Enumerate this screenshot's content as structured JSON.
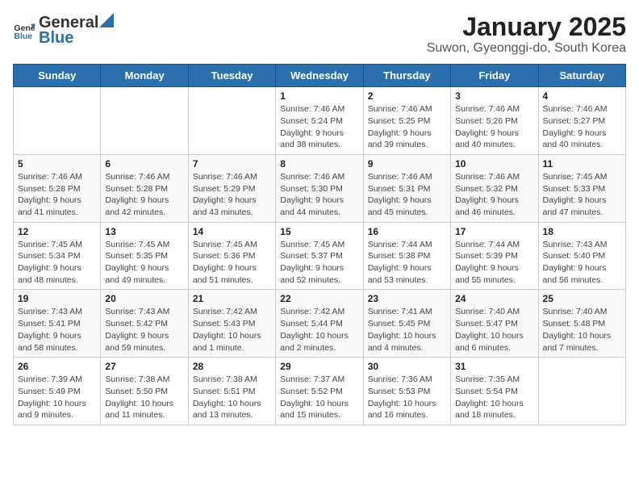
{
  "header": {
    "logo_general": "General",
    "logo_blue": "Blue",
    "title": "January 2025",
    "subtitle": "Suwon, Gyeonggi-do, South Korea"
  },
  "weekdays": [
    "Sunday",
    "Monday",
    "Tuesday",
    "Wednesday",
    "Thursday",
    "Friday",
    "Saturday"
  ],
  "weeks": [
    [
      {
        "day": "",
        "info": ""
      },
      {
        "day": "",
        "info": ""
      },
      {
        "day": "",
        "info": ""
      },
      {
        "day": "1",
        "info": "Sunrise: 7:46 AM\nSunset: 5:24 PM\nDaylight: 9 hours and 38 minutes."
      },
      {
        "day": "2",
        "info": "Sunrise: 7:46 AM\nSunset: 5:25 PM\nDaylight: 9 hours and 39 minutes."
      },
      {
        "day": "3",
        "info": "Sunrise: 7:46 AM\nSunset: 5:26 PM\nDaylight: 9 hours and 40 minutes."
      },
      {
        "day": "4",
        "info": "Sunrise: 7:46 AM\nSunset: 5:27 PM\nDaylight: 9 hours and 40 minutes."
      }
    ],
    [
      {
        "day": "5",
        "info": "Sunrise: 7:46 AM\nSunset: 5:28 PM\nDaylight: 9 hours and 41 minutes."
      },
      {
        "day": "6",
        "info": "Sunrise: 7:46 AM\nSunset: 5:28 PM\nDaylight: 9 hours and 42 minutes."
      },
      {
        "day": "7",
        "info": "Sunrise: 7:46 AM\nSunset: 5:29 PM\nDaylight: 9 hours and 43 minutes."
      },
      {
        "day": "8",
        "info": "Sunrise: 7:46 AM\nSunset: 5:30 PM\nDaylight: 9 hours and 44 minutes."
      },
      {
        "day": "9",
        "info": "Sunrise: 7:46 AM\nSunset: 5:31 PM\nDaylight: 9 hours and 45 minutes."
      },
      {
        "day": "10",
        "info": "Sunrise: 7:46 AM\nSunset: 5:32 PM\nDaylight: 9 hours and 46 minutes."
      },
      {
        "day": "11",
        "info": "Sunrise: 7:45 AM\nSunset: 5:33 PM\nDaylight: 9 hours and 47 minutes."
      }
    ],
    [
      {
        "day": "12",
        "info": "Sunrise: 7:45 AM\nSunset: 5:34 PM\nDaylight: 9 hours and 48 minutes."
      },
      {
        "day": "13",
        "info": "Sunrise: 7:45 AM\nSunset: 5:35 PM\nDaylight: 9 hours and 49 minutes."
      },
      {
        "day": "14",
        "info": "Sunrise: 7:45 AM\nSunset: 5:36 PM\nDaylight: 9 hours and 51 minutes."
      },
      {
        "day": "15",
        "info": "Sunrise: 7:45 AM\nSunset: 5:37 PM\nDaylight: 9 hours and 52 minutes."
      },
      {
        "day": "16",
        "info": "Sunrise: 7:44 AM\nSunset: 5:38 PM\nDaylight: 9 hours and 53 minutes."
      },
      {
        "day": "17",
        "info": "Sunrise: 7:44 AM\nSunset: 5:39 PM\nDaylight: 9 hours and 55 minutes."
      },
      {
        "day": "18",
        "info": "Sunrise: 7:43 AM\nSunset: 5:40 PM\nDaylight: 9 hours and 56 minutes."
      }
    ],
    [
      {
        "day": "19",
        "info": "Sunrise: 7:43 AM\nSunset: 5:41 PM\nDaylight: 9 hours and 58 minutes."
      },
      {
        "day": "20",
        "info": "Sunrise: 7:43 AM\nSunset: 5:42 PM\nDaylight: 9 hours and 59 minutes."
      },
      {
        "day": "21",
        "info": "Sunrise: 7:42 AM\nSunset: 5:43 PM\nDaylight: 10 hours and 1 minute."
      },
      {
        "day": "22",
        "info": "Sunrise: 7:42 AM\nSunset: 5:44 PM\nDaylight: 10 hours and 2 minutes."
      },
      {
        "day": "23",
        "info": "Sunrise: 7:41 AM\nSunset: 5:45 PM\nDaylight: 10 hours and 4 minutes."
      },
      {
        "day": "24",
        "info": "Sunrise: 7:40 AM\nSunset: 5:47 PM\nDaylight: 10 hours and 6 minutes."
      },
      {
        "day": "25",
        "info": "Sunrise: 7:40 AM\nSunset: 5:48 PM\nDaylight: 10 hours and 7 minutes."
      }
    ],
    [
      {
        "day": "26",
        "info": "Sunrise: 7:39 AM\nSunset: 5:49 PM\nDaylight: 10 hours and 9 minutes."
      },
      {
        "day": "27",
        "info": "Sunrise: 7:38 AM\nSunset: 5:50 PM\nDaylight: 10 hours and 11 minutes."
      },
      {
        "day": "28",
        "info": "Sunrise: 7:38 AM\nSunset: 5:51 PM\nDaylight: 10 hours and 13 minutes."
      },
      {
        "day": "29",
        "info": "Sunrise: 7:37 AM\nSunset: 5:52 PM\nDaylight: 10 hours and 15 minutes."
      },
      {
        "day": "30",
        "info": "Sunrise: 7:36 AM\nSunset: 5:53 PM\nDaylight: 10 hours and 16 minutes."
      },
      {
        "day": "31",
        "info": "Sunrise: 7:35 AM\nSunset: 5:54 PM\nDaylight: 10 hours and 18 minutes."
      },
      {
        "day": "",
        "info": ""
      }
    ]
  ]
}
